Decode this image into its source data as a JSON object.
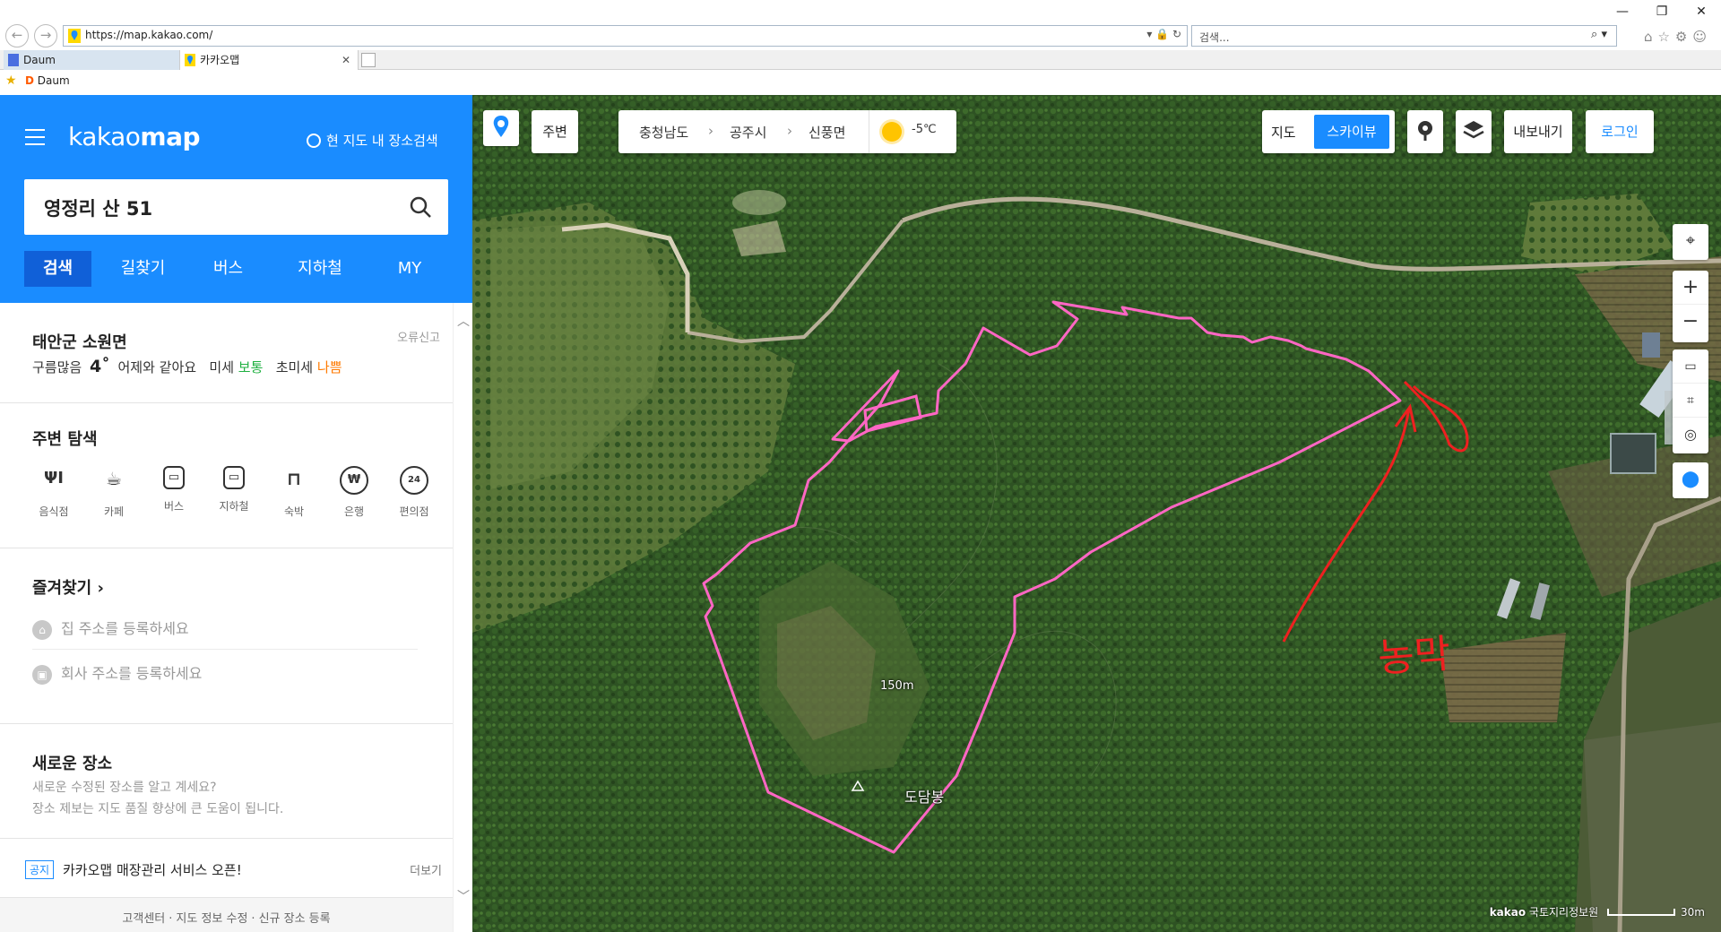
{
  "browser": {
    "url": "https://map.kakao.com/",
    "search_placeholder": "검색...",
    "tabs": [
      {
        "label": "Daum"
      },
      {
        "label": "카카오맵"
      }
    ],
    "favorites_bar": [
      "Daum"
    ],
    "window_controls": [
      "—",
      "❐",
      "✕"
    ]
  },
  "sidebar": {
    "logo_light": "kakao",
    "logo_bold": "map",
    "map_area_search": "현 지도 내 장소검색",
    "search_value": "영정리 산 51",
    "tabs": [
      "검색",
      "길찾기",
      "버스",
      "지하철",
      "MY"
    ],
    "weather": {
      "location": "태안군 소원면",
      "report": "오류신고",
      "condition": "구름많음",
      "temperature": "4˚",
      "compare": "어제와 같아요",
      "fine_dust_label": "미세",
      "fine_dust_value": "보통",
      "ultrafine_label": "초미세",
      "ultrafine_value": "나쁨"
    },
    "nearby": {
      "title": "주변 탐색",
      "categories": [
        {
          "label": "음식점",
          "icon": "restaurant-icon"
        },
        {
          "label": "카페",
          "icon": "cafe-icon"
        },
        {
          "label": "버스",
          "icon": "bus-icon"
        },
        {
          "label": "지하철",
          "icon": "subway-icon"
        },
        {
          "label": "숙박",
          "icon": "lodging-icon"
        },
        {
          "label": "은행",
          "icon": "bank-icon"
        },
        {
          "label": "편의점",
          "icon": "convenience-store-icon"
        }
      ]
    },
    "favorites": {
      "title": "즐겨찾기",
      "home": "집 주소를 등록하세요",
      "work": "회사 주소를 등록하세요"
    },
    "new_place": {
      "title": "새로운 장소",
      "desc1": "새로운 수정된 장소를 알고 계세요?",
      "desc2": "장소 제보는 지도 품질 향상에 큰 도움이 됩니다."
    },
    "notice": {
      "badge": "공지",
      "text": "카카오맵 매장관리 서비스 오픈!",
      "more": "더보기"
    },
    "footer": [
      "고객센터",
      "지도 정보 수정",
      "신규 장소 등록"
    ]
  },
  "map": {
    "nearby_button": "주변",
    "breadcrumb": [
      "충청남도",
      "공주시",
      "신풍면"
    ],
    "weather_temp": "-5℃",
    "view_map": "지도",
    "view_sky": "스카이뷰",
    "export_button": "내보내기",
    "login_button": "로그인",
    "elevation_label": "150m",
    "peak_name": "도담봉",
    "handwritten_note": "농막",
    "attribution": "kakao",
    "attribution_source": "국토지리정보원",
    "scale_label": "30m",
    "colors": {
      "accent": "#1a8cff",
      "boundary": "#ff5fbf",
      "annotation": "#ee2020"
    }
  }
}
